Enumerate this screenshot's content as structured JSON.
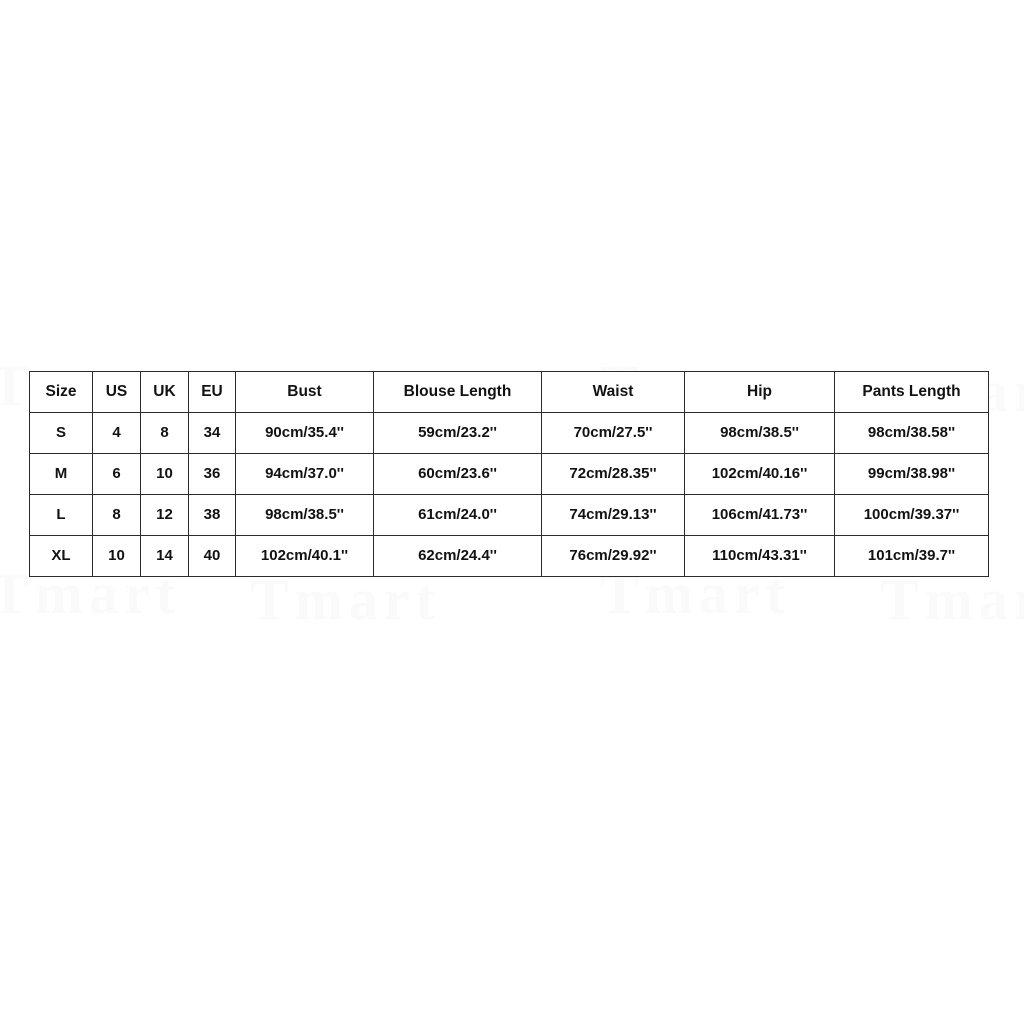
{
  "background_color": "#ffffff",
  "table_border_color": "#2b2b2b",
  "text_color": "#121212",
  "watermark": {
    "color": "#fafafa",
    "tiles": [
      "Tmart",
      "Tmart",
      "Tmart",
      "Tmart",
      "Tmart",
      "Tmart",
      "Tmart",
      "Tmart"
    ]
  },
  "size_chart": {
    "type": "table",
    "columns": [
      "Size",
      "US",
      "UK",
      "EU",
      "Bust",
      "Blouse Length",
      "Waist",
      "Hip",
      "Pants Length"
    ],
    "rows": [
      {
        "size": "S",
        "us": "4",
        "uk": "8",
        "eu": "34",
        "bust": "90cm/35.4''",
        "blouse_length": "59cm/23.2''",
        "waist": "70cm/27.5''",
        "hip": "98cm/38.5''",
        "pants_length": "98cm/38.58''"
      },
      {
        "size": "M",
        "us": "6",
        "uk": "10",
        "eu": "36",
        "bust": "94cm/37.0''",
        "blouse_length": "60cm/23.6''",
        "waist": "72cm/28.35''",
        "hip": "102cm/40.16''",
        "pants_length": "99cm/38.98''"
      },
      {
        "size": "L",
        "us": "8",
        "uk": "12",
        "eu": "38",
        "bust": "98cm/38.5''",
        "blouse_length": "61cm/24.0''",
        "waist": "74cm/29.13''",
        "hip": "106cm/41.73''",
        "pants_length": "100cm/39.37''"
      },
      {
        "size": "XL",
        "us": "10",
        "uk": "14",
        "eu": "40",
        "bust": "102cm/40.1''",
        "blouse_length": "62cm/24.4''",
        "waist": "76cm/29.92''",
        "hip": "110cm/43.31''",
        "pants_length": "101cm/39.7''"
      }
    ]
  }
}
